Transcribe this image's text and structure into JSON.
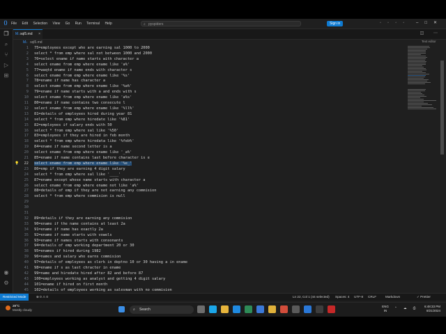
{
  "window": {
    "menu": [
      "File",
      "Edit",
      "Selection",
      "View",
      "Go",
      "Run",
      "Terminal",
      "Help"
    ],
    "search_text": "pyspiders",
    "signin_label": "Sign in"
  },
  "tab": {
    "label": "sql5.md"
  },
  "breadcrumb": {
    "file": "sql5.md"
  },
  "minimap_label": "Text editor",
  "editor": {
    "lines": [
      {
        "n": "1",
        "text": "75=employees except who are earning sal 1000 to 2000"
      },
      {
        "n": "2",
        "text": "select * from emp where sal not between 1000 and 2000"
      },
      {
        "n": "3",
        "text": "76=select ename if name starts with character a"
      },
      {
        "n": "4",
        "text": "select ename from emp where ename like 'a%'"
      },
      {
        "n": "5",
        "text": "77=waqtd ename if name ends with character s"
      },
      {
        "n": "6",
        "text": "select ename from emp where ename like '%s'"
      },
      {
        "n": "7",
        "text": "78=ename if name has character a"
      },
      {
        "n": "8",
        "text": "select ename from emp where ename like '%a%'"
      },
      {
        "n": "9",
        "text": "79=ename if name starts with a and ends with s"
      },
      {
        "n": "10",
        "text": "select ename from emp where ename like 'a%s'"
      },
      {
        "n": "11",
        "text": "80=ename if name contains two consecute l"
      },
      {
        "n": "12",
        "text": "select ename from emp where ename like '%ll%'"
      },
      {
        "n": "13",
        "text": "81=details of employees hired during year 81"
      },
      {
        "n": "14",
        "text": "select * from emp where hiredate like '%81'"
      },
      {
        "n": "15",
        "text": "82=employees if salary ends with 50"
      },
      {
        "n": "16",
        "text": "select * from emp where sal like '%50'"
      },
      {
        "n": "17",
        "text": "83=employees if they are hired in feb month"
      },
      {
        "n": "18",
        "text": "select * from emp where hiredata like '%feb%'"
      },
      {
        "n": "19",
        "text": "84=ename if name second letter is a"
      },
      {
        "n": "20",
        "text": "select ename from emp where ename like '_a%'"
      },
      {
        "n": "21",
        "text": "85=ename if name contains last before character is e"
      },
      {
        "n": "22",
        "text": "select ename from emp where ename like '%e_'"
      },
      {
        "n": "23",
        "text": "86=emp if they are earning 4 digit salary"
      },
      {
        "n": "24",
        "text": "select * from emp where sal like '____'"
      },
      {
        "n": "25",
        "text": "87=ename except whose name starts with character a"
      },
      {
        "n": "26",
        "text": "select ename from emp where ename not like 'a%'"
      },
      {
        "n": "27",
        "text": "88=details of emp if they are not earning any commision"
      },
      {
        "n": "28",
        "text": "select * from emp where commision is null"
      },
      {
        "n": "29",
        "text": ""
      },
      {
        "n": "30",
        "text": ""
      },
      {
        "n": "31",
        "text": ""
      },
      {
        "n": "32",
        "text": "89=details if they are earning any commision"
      },
      {
        "n": "33",
        "text": "90=ename if the name contains at least 2a"
      },
      {
        "n": "34",
        "text": "91=ename if name has exactly 2a"
      },
      {
        "n": "35",
        "text": "92=ename if name starts with vowels"
      },
      {
        "n": "36",
        "text": "93=ename if names starts with consonants"
      },
      {
        "n": "37",
        "text": "94=details of emp working department 20 or 30"
      },
      {
        "n": "38",
        "text": "95=enames if hired during 1982"
      },
      {
        "n": "39",
        "text": "96=names and salary who earns commision"
      },
      {
        "n": "40",
        "text": "97=details of employees as clerk in deptno 10 or 30 having a in ename"
      },
      {
        "n": "41",
        "text": "98=ename if s as last chracter in ename"
      },
      {
        "n": "42",
        "text": "99=name and hiredate hired after 82 and before 87"
      },
      {
        "n": "43",
        "text": "100=employees working as analyst and getting 4 digit salary"
      },
      {
        "n": "44",
        "text": "101=ename if hired on first month"
      },
      {
        "n": "45",
        "text": "102=details of employees working as salesman with no commision"
      },
      {
        "n": "46",
        "text": "103=select ename and sal hired in 99 into department number 10 and 40"
      }
    ],
    "selected_line": "22"
  },
  "status": {
    "mode": "Restricted Mode",
    "errors": "⊗ 0 ⚠ 0",
    "position": "Ln 22, Col 1 (44 selected)",
    "spaces": "Spaces: 4",
    "encoding": "UTF-8",
    "eol": "CRLF",
    "language": "Markdown",
    "prettier": "✓ Prettier"
  },
  "taskbar": {
    "temp": "28°C",
    "weather": "Mostly cloudy",
    "search": "Search",
    "lang1": "ENG",
    "lang2": "IN",
    "time": "6:48:33 PM",
    "date": "8/21/2024"
  }
}
